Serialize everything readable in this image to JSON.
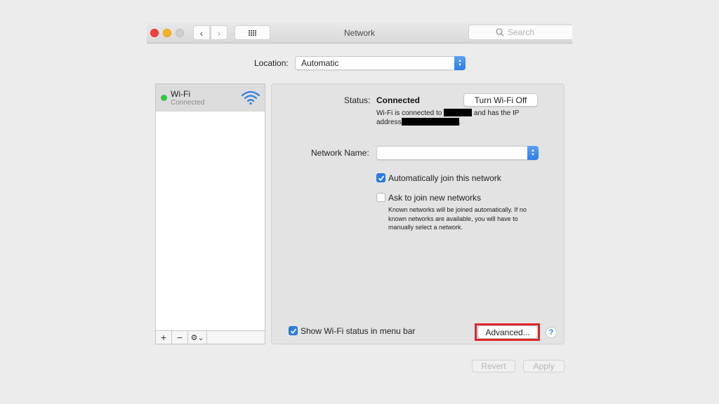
{
  "window": {
    "title": "Network",
    "search_placeholder": "Search",
    "icons": {
      "close": "close-dot",
      "minimize": "minimize-dot",
      "zoom": "zoom-dot",
      "back": "chevron-left-icon",
      "forward": "chevron-right-icon",
      "show_all": "grid-icon",
      "search": "magnifier-icon"
    }
  },
  "location": {
    "label": "Location:",
    "value": "Automatic"
  },
  "sidebar": {
    "items": [
      {
        "name": "Wi-Fi",
        "status": "Connected",
        "status_color": "#2ecb3e",
        "icon": "wifi-icon"
      }
    ],
    "footer": {
      "add": "+",
      "remove": "−",
      "gear": "⚙⌄"
    }
  },
  "panel": {
    "status_label": "Status:",
    "status_value": "Connected",
    "turn_off_label": "Turn Wi-Fi Off",
    "status_desc_1": "Wi-Fi is connected to ",
    "status_desc_2": " and has the IP address",
    "status_desc_3": ".",
    "network_name_label": "Network Name:",
    "network_name_value": "",
    "auto_join_label": "Automatically join this network",
    "auto_join_checked": true,
    "ask_join_label": "Ask to join new networks",
    "ask_join_checked": false,
    "ask_join_help": "Known networks will be joined automatically. If no known networks are available, you will have to manually select a network.",
    "show_status_label": "Show Wi-Fi status in menu bar",
    "show_status_checked": true,
    "advanced_label": "Advanced...",
    "help_label": "?"
  },
  "footer": {
    "revert_label": "Revert",
    "apply_label": "Apply"
  },
  "colors": {
    "accent": "#2b7de9",
    "highlight": "#e0262a",
    "connected": "#2ecb3e"
  }
}
